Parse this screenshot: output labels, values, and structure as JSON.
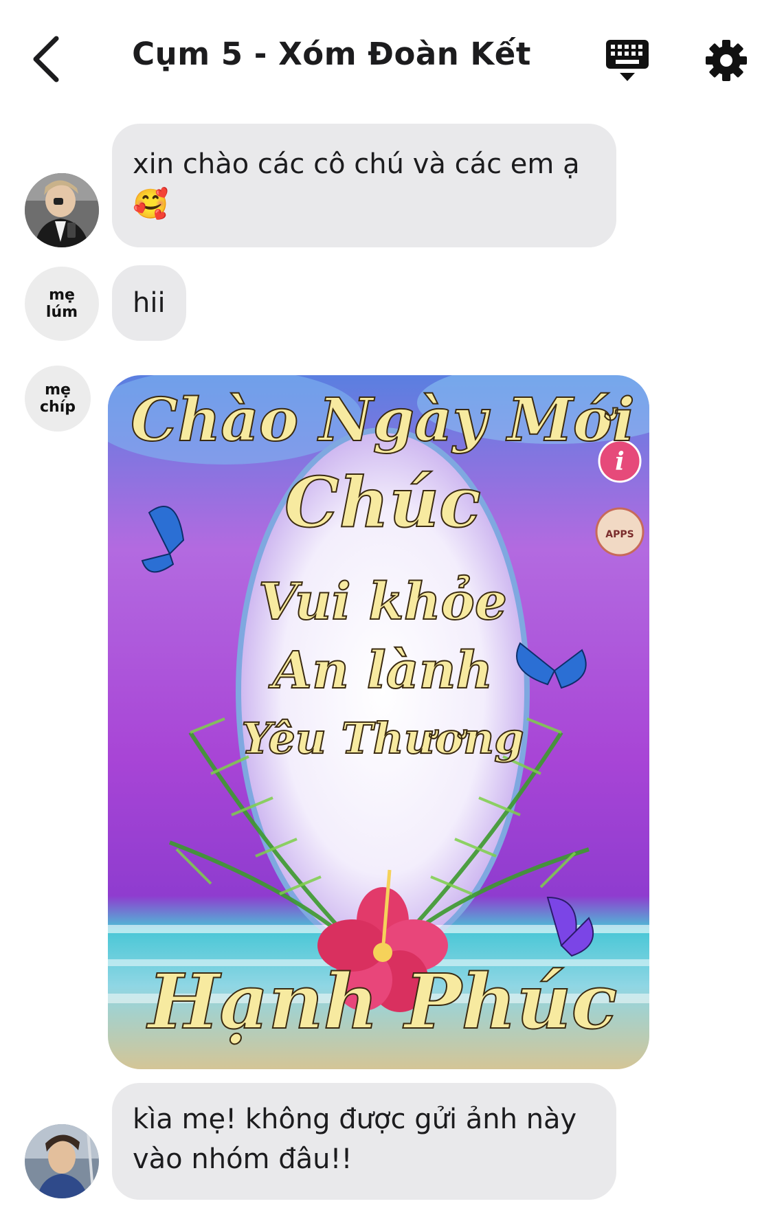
{
  "header": {
    "title": "Cụm 5 - Xóm Đoàn Kết"
  },
  "messages": [
    {
      "sender": "",
      "lines": [
        "xin chào các cô chú và các em ạ"
      ],
      "emoji": "🥰"
    },
    {
      "sender": "mẹ lúm",
      "avatar_lines": [
        "mẹ",
        "lúm"
      ],
      "lines": [
        "hii"
      ]
    },
    {
      "sender": "mẹ chíp",
      "avatar_lines": [
        "mẹ",
        "chíp"
      ],
      "image": {
        "texts": [
          "Chào Ngày Mới",
          "Chúc",
          "Vui khỏe",
          "An lành",
          "Yêu Thương",
          "Hạnh Phúc"
        ],
        "badge": "APPS"
      }
    },
    {
      "sender": "",
      "lines": [
        "kìa mẹ! không được gửi ảnh này",
        "vào nhóm đâu!!"
      ]
    }
  ],
  "icons": {
    "back": "chevron-left-icon",
    "keyboard": "keyboard-icon",
    "settings": "gear-icon"
  },
  "colors": {
    "bubble": "#e9e9eb",
    "avatar_bg": "#ececec",
    "text": "#1c1c1e"
  }
}
